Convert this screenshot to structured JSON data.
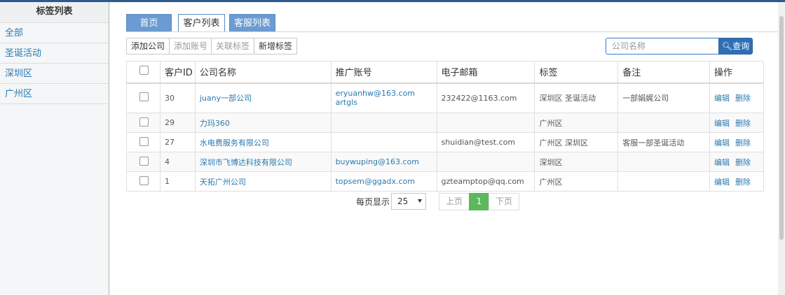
{
  "sidebar": {
    "title": "标签列表",
    "items": [
      {
        "label": "全部"
      },
      {
        "label": "圣诞活动"
      },
      {
        "label": "深圳区"
      },
      {
        "label": "广州区"
      }
    ]
  },
  "tabs": [
    {
      "label": "首页",
      "active": false
    },
    {
      "label": "客户列表",
      "active": true
    },
    {
      "label": "客服列表",
      "active": false
    }
  ],
  "toolbar": {
    "add_company": "添加公司",
    "add_account": "添加账号",
    "link_tag": "关联标签",
    "new_tag": "新增标签"
  },
  "search": {
    "placeholder": "公司名称",
    "button": "查询"
  },
  "table": {
    "headers": [
      "客户ID",
      "公司名称",
      "推广账号",
      "电子邮箱",
      "标签",
      "备注",
      "操作"
    ],
    "rows": [
      {
        "id": "30",
        "company": "juany一部公司",
        "account": "eryuanhw@163.com",
        "account2": "artgls",
        "email": "232422@1163.com",
        "tags": "深圳区 圣诞活动",
        "note": "一部娟娓公司",
        "edit": "编辑",
        "delete": "删除"
      },
      {
        "id": "29",
        "company": "力玛360",
        "account": "",
        "account2": "",
        "email": "",
        "tags": "广州区",
        "note": "",
        "edit": "编辑",
        "delete": "删除"
      },
      {
        "id": "27",
        "company": "水电费服务有限公司",
        "account": "",
        "account2": "",
        "email": "shuidian@test.com",
        "tags": "广州区 深圳区",
        "note": "客服一部圣诞活动",
        "edit": "编辑",
        "delete": "删除"
      },
      {
        "id": "4",
        "company": "深圳市飞博达科技有限公司",
        "account": "buywuping@163.com",
        "account2": "",
        "email": "",
        "tags": "深圳区",
        "note": "",
        "edit": "编辑",
        "delete": "删除"
      },
      {
        "id": "1",
        "company": "天拓广州公司",
        "account": "topsem@ggadx.com",
        "account2": "",
        "email": "gzteamptop@qq.com",
        "tags": "广州区",
        "note": "",
        "edit": "编辑",
        "delete": "删除"
      }
    ]
  },
  "pager": {
    "per_page_label": "每页显示",
    "per_page_value": "25",
    "prev": "上页",
    "current": "1",
    "next": "下页"
  },
  "colors": {
    "accent": "#2f6fb5",
    "link": "#2a7ab0",
    "current_page": "#5cb85c"
  }
}
